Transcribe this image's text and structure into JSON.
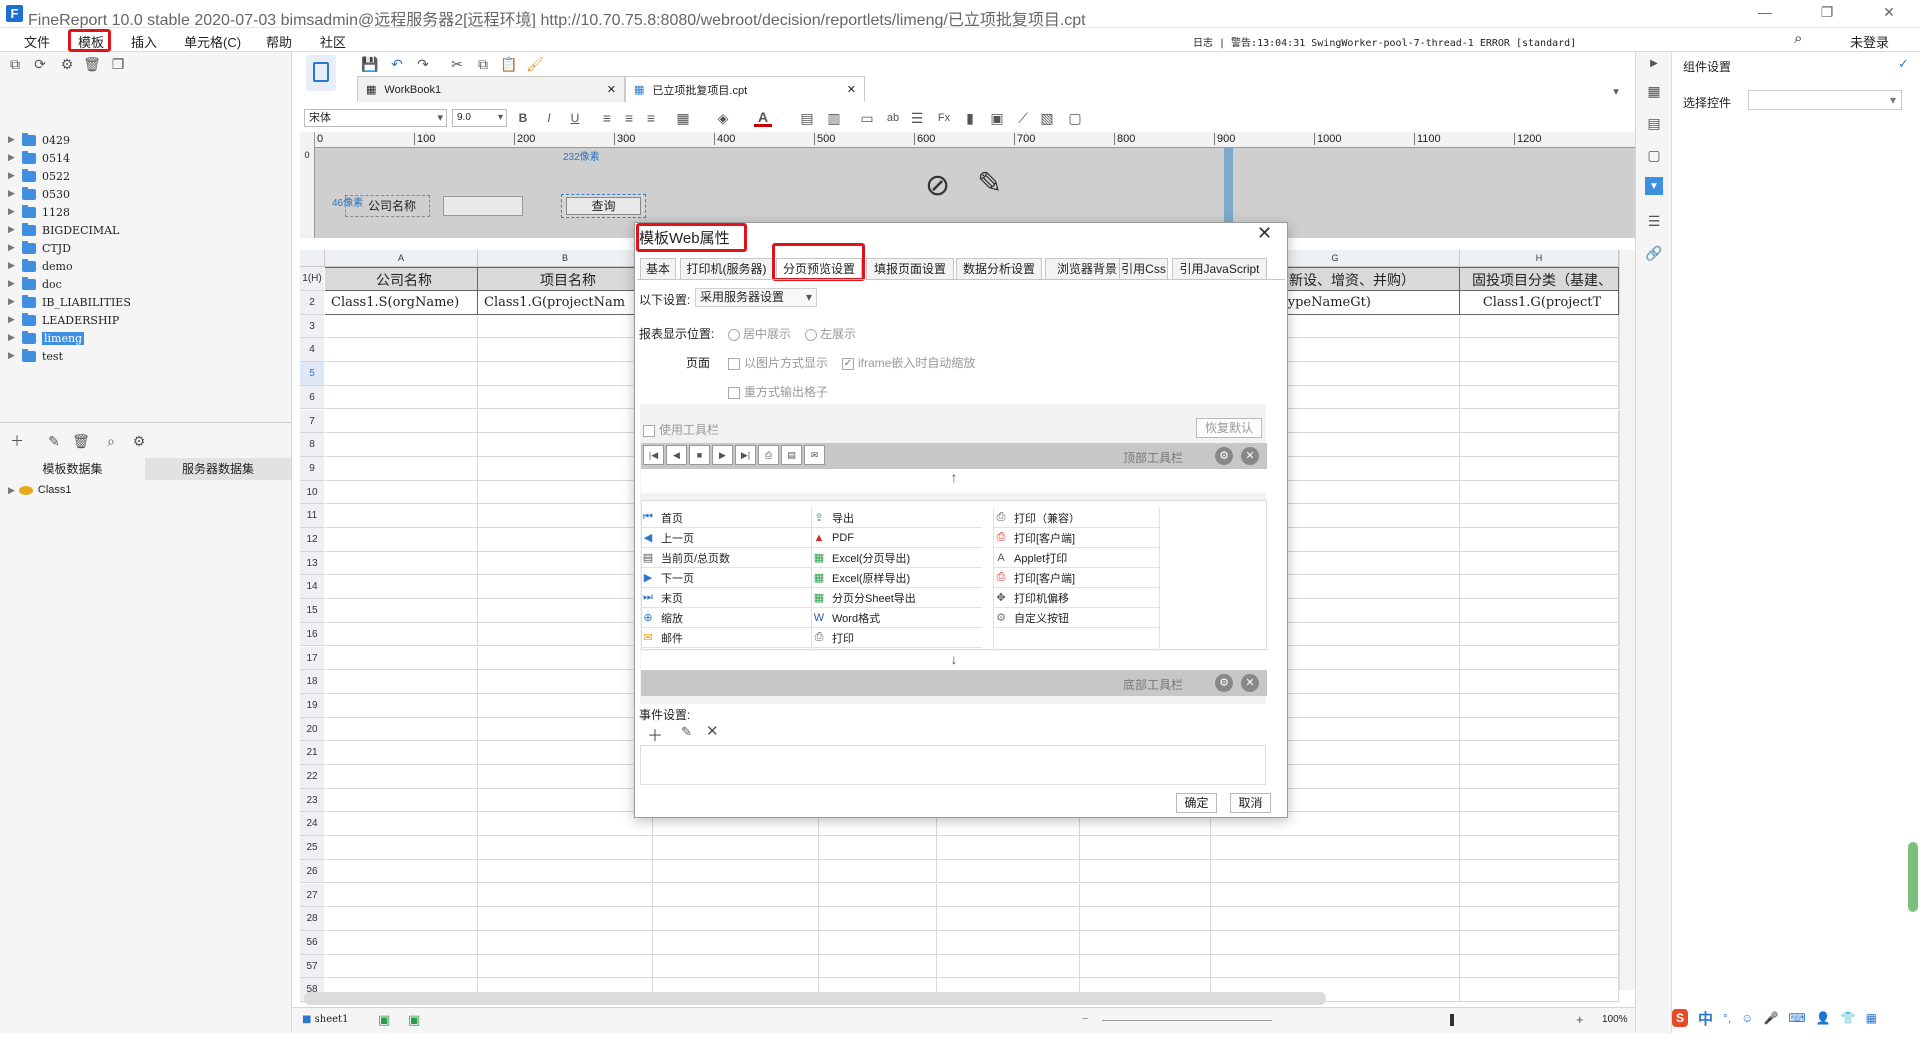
{
  "window": {
    "title": "FineReport 10.0 stable 2020-07-03 bimsadmin@远程服务器2[远程环境]    http://10.70.75.8:8080/webroot/decision/reportlets/limeng/已立项批复项目.cpt",
    "status_log": "日志 | 警告:13:04:31 SwingWorker-pool-7-thread-1 ERROR [standard]",
    "login": "未登录"
  },
  "menubar": [
    "文件",
    "模板",
    "插入",
    "单元格(C)",
    "帮助",
    "社区"
  ],
  "tree": {
    "items": [
      "0429",
      "0514",
      "0522",
      "0530",
      "1128",
      "BIGDECIMAL",
      "CTJD",
      "demo",
      "doc",
      "IB_LIABILITIES",
      "LEADERSHIP",
      "limeng",
      "test"
    ],
    "selected": "limeng"
  },
  "dataset_tabs": [
    "模板数据集",
    "服务器数据集"
  ],
  "dataset_items": [
    "Class1"
  ],
  "editor_tabs": [
    "WorkBook1",
    "已立项批复项目.cpt"
  ],
  "format": {
    "font": "宋体",
    "size": "9.0"
  },
  "ruler": [
    "0",
    "100",
    "200",
    "300",
    "400",
    "500",
    "600",
    "700",
    "800",
    "900",
    "1000",
    "1100",
    "1200"
  ],
  "param_pane": {
    "label": "公司名称",
    "button": "查询",
    "dim_w": "232像素",
    "dim_h": "46像素"
  },
  "sheet": {
    "col_letters": [
      "A",
      "B",
      "G",
      "H"
    ],
    "header_row": [
      "公司名称",
      "项目名称",
      "类（新设、增资、并购）",
      "固投项目分类（基建、"
    ],
    "data_row": [
      "Class1.S(orgName)",
      "Class1.G(projectNam",
      "G(projectTypeNameGt)",
      "Class1.G(projectT"
    ],
    "row_numbers": [
      "1(H)",
      "2",
      "3",
      "4",
      "5",
      "6",
      "7",
      "8",
      "9",
      "10",
      "11",
      "12",
      "13",
      "14",
      "15",
      "16",
      "17",
      "18",
      "19",
      "20",
      "21",
      "22",
      "23",
      "24",
      "25",
      "26",
      "27",
      "28",
      "56",
      "57",
      "58"
    ],
    "sheet_tab": "sheet1",
    "zoom": "100%"
  },
  "dialog": {
    "title": "模板Web属性",
    "tabs": [
      "基本",
      "打印机(服务器)",
      "分页预览设置",
      "填报页面设置",
      "数据分析设置",
      "浏览器背景",
      "引用Css",
      "引用JavaScript"
    ],
    "active_tab": "分页预览设置",
    "settings_label": "以下设置:",
    "settings_value": "采用服务器设置",
    "position_label": "报表显示位置:",
    "position_center": "居中展示",
    "position_left": "左展示",
    "page_label": "页面",
    "opt_image": "以图片方式显示",
    "opt_iframe": "iframe嵌入时自动缩放",
    "opt_repeat": "重方式输出格子",
    "use_toolbar": "使用工具栏",
    "restore_default": "恢复默认",
    "top_toolbar": "顶部工具栏",
    "bottom_toolbar": "底部工具栏",
    "buttons_col1": [
      "首页",
      "上一页",
      "当前页/总页数",
      "下一页",
      "末页",
      "缩放",
      "邮件"
    ],
    "buttons_col2": [
      "导出",
      "PDF",
      "Excel(分页导出)",
      "Excel(原样导出)",
      "分页分Sheet导出",
      "Word格式",
      "打印"
    ],
    "buttons_col3": [
      "打印（兼容）",
      "打印[客户端]",
      "Applet打印",
      "打印[客户端]",
      "打印机偏移",
      "自定义按钮"
    ],
    "event_label": "事件设置:",
    "ok": "确定",
    "cancel": "取消"
  },
  "right_panel": {
    "title": "组件设置",
    "select_label": "选择控件"
  }
}
